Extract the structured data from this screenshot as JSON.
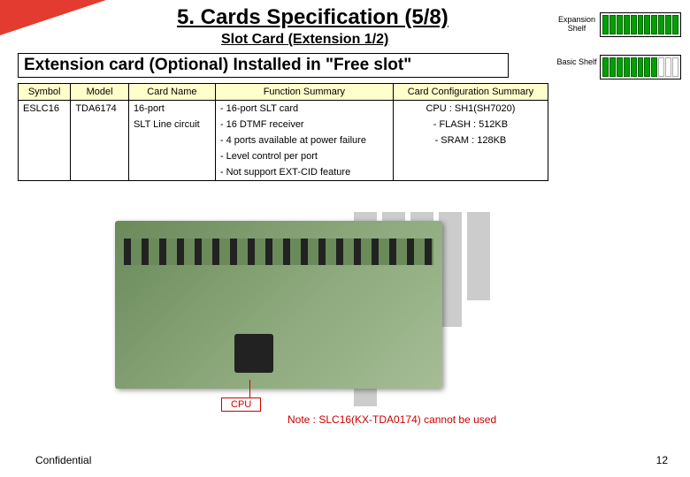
{
  "header": {
    "title": "5. Cards Specification (5/8)",
    "subtitle": "Slot Card (Extension 1/2)",
    "section": "Extension card (Optional) Installed in \"Free slot\""
  },
  "shelves": {
    "expansion_label": "Expansion Shelf",
    "basic_label": "Basic Shelf"
  },
  "table": {
    "headers": [
      "Symbol",
      "Model",
      "Card Name",
      "Function Summary",
      "Card Configuration Summary"
    ],
    "row": {
      "symbol": "ESLC16",
      "model": "TDA6174",
      "card_name_1": "16-port",
      "card_name_2": "SLT Line circuit",
      "func_1": "- 16-port SLT card",
      "func_2": "- 16 DTMF receiver",
      "func_3": "- 4 ports available at power failure",
      "func_4": "- Level control per port",
      "func_5": "- Not support EXT-CID feature",
      "cfg_1": "CPU : SH1(SH7020)",
      "cfg_2": "- FLASH : 512KB",
      "cfg_3": "- SRAM : 128KB"
    }
  },
  "callouts": {
    "cpu": "CPU"
  },
  "note": "Note : SLC16(KX-TDA0174) cannot be used",
  "footer": {
    "left": "Confidential",
    "right": "12"
  }
}
